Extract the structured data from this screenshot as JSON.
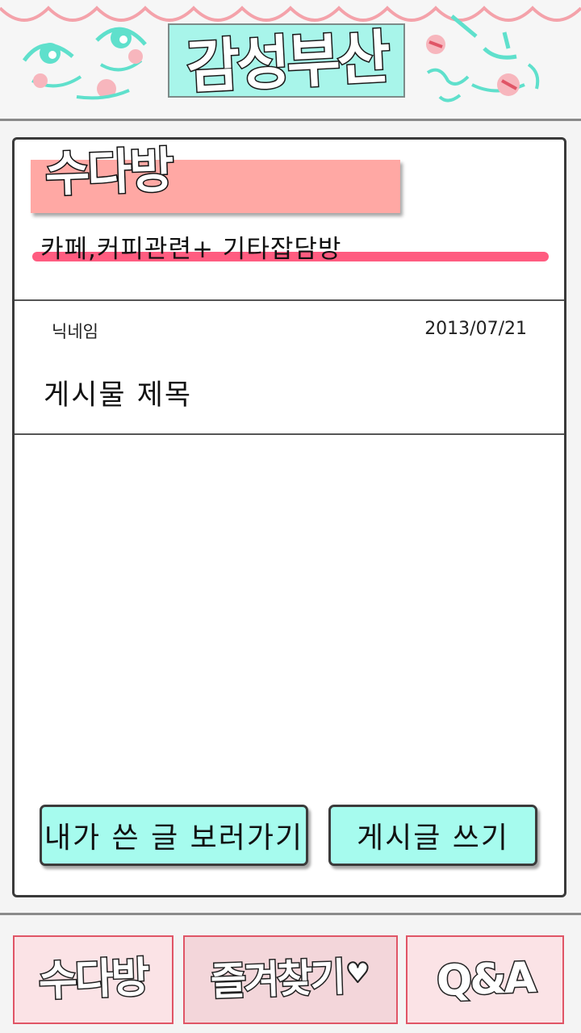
{
  "header": {
    "logo_text": "감성부산"
  },
  "board": {
    "title": "수다방",
    "description": "카페,커피관련+ 기타잡담방"
  },
  "post": {
    "author": "닉네임",
    "date": "2013/07/21",
    "title": "게시물 제목"
  },
  "actions": {
    "my_posts_label": "내가 쓴 글 보러가기",
    "write_label": "게시글 쓰기"
  },
  "bottom_nav": {
    "items": [
      {
        "label": "수다방"
      },
      {
        "label": "즐겨찾기"
      },
      {
        "label": "Q&A"
      }
    ]
  },
  "colors": {
    "logo_bg": "#a8f5ea",
    "title_bar": "#ffa8a4",
    "underline": "#ff5c80",
    "button_bg": "#a6fbee",
    "nav_bg": "#fbe3e6",
    "nav_border": "#e05566"
  }
}
